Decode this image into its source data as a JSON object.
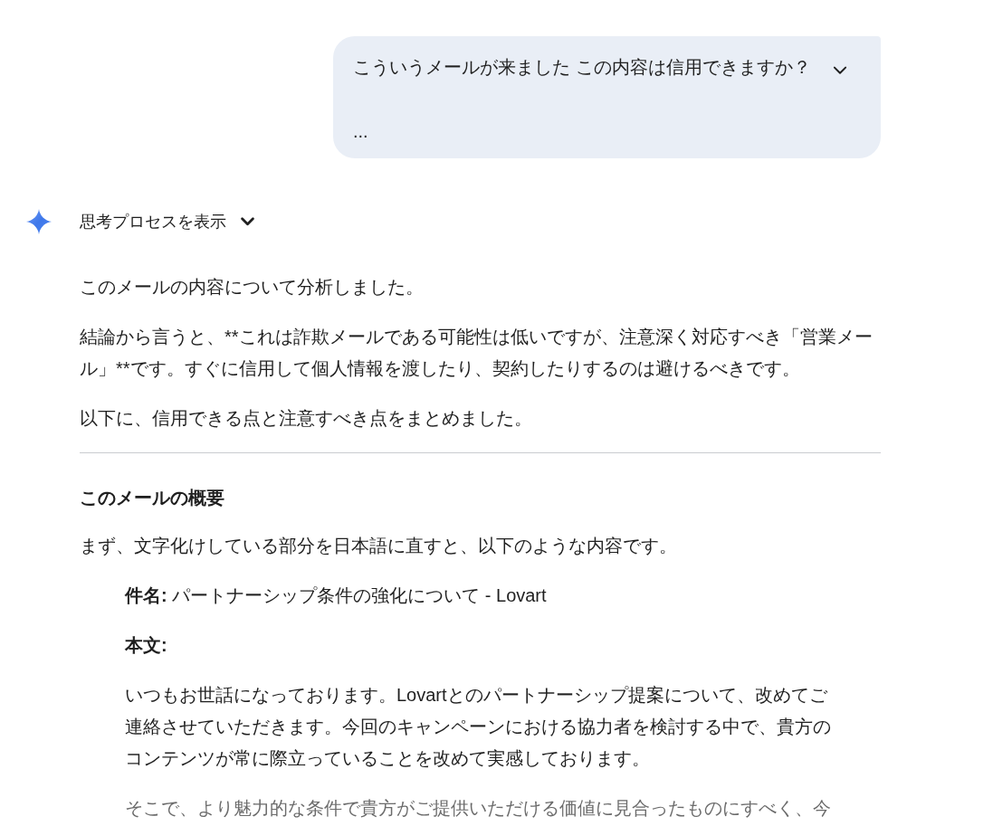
{
  "user_message": {
    "text": "こういうメールが来ました この内容は信用できますか？",
    "continuation": "...",
    "expanded": false
  },
  "response": {
    "thoughts_toggle": {
      "label": "思考プロセスを表示",
      "expanded": false
    },
    "intro_paragraphs": [
      "このメールの内容について分析しました。",
      "結論から言うと、**これは詐欺メールである可能性は低いですが、注意深く対応すべき「営業メール」**です。すぐに信用して個人情報を渡したり、契約したりするのは避けるべきです。",
      "以下に、信用できる点と注意すべき点をまとめました。"
    ],
    "section": {
      "heading": "このメールの概要",
      "lead": "まず、文字化けしている部分を日本語に直すと、以下のような内容です。",
      "quote": {
        "subject": "**件名:** パートナーシップ条件の強化について - Lovart",
        "body_label": "本文:",
        "body_paragraphs": [
          {
            "text": "いつもお世話になっております。Lovartとのパートナーシップ提案について、改めてご連絡させていただきます。今回のキャンペーンにおける協力者を検討する中で、貴方のコンテンツが常に際立っていることを改めて実感しております。",
            "faded": false
          },
          {
            "text": "そこで、より魅力的な条件で貴方がご提供いただける価値に見合ったものにすべく、今",
            "faded": true
          }
        ]
      }
    }
  }
}
